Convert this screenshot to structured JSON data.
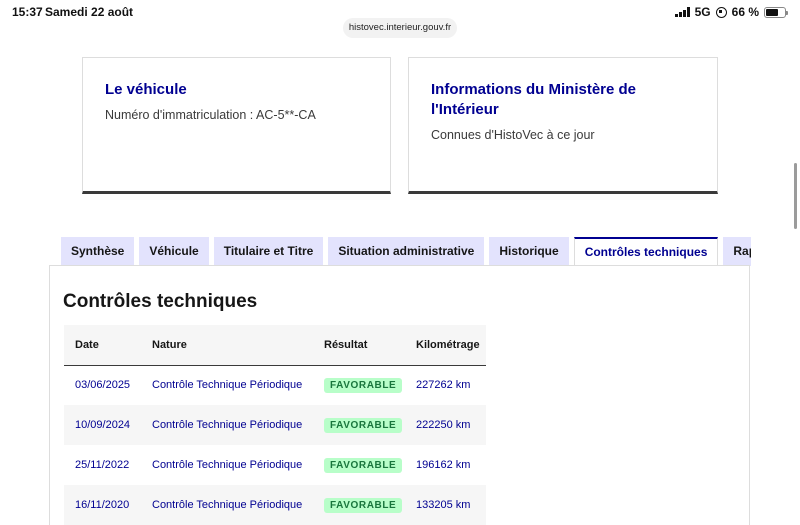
{
  "status_bar": {
    "time": "15:37",
    "date": "Samedi 22 août",
    "network": "5G",
    "battery": "66 %",
    "battery_level": 0.66
  },
  "browser": {
    "url": "histovec.interieur.gouv.fr"
  },
  "cards": [
    {
      "title": "Le véhicule",
      "text": "Numéro d'immatriculation : AC-5**-CA"
    },
    {
      "title_line1": "Informations du Ministère de",
      "title_line2": "l'Intérieur",
      "text": "Connues d'HistoVec à ce jour"
    }
  ],
  "tabs": [
    {
      "label": "Synthèse"
    },
    {
      "label": "Véhicule"
    },
    {
      "label": "Titulaire et Titre"
    },
    {
      "label": "Situation administrative"
    },
    {
      "label": "Historique"
    },
    {
      "label": "Contrôles techniques"
    },
    {
      "label": "Rap"
    }
  ],
  "active_tab": "Contrôles techniques",
  "section": {
    "title": "Contrôles techniques",
    "columns": [
      "Date",
      "Nature",
      "Résultat",
      "Kilométrage"
    ],
    "rows": [
      {
        "date": "03/06/2025",
        "nature": "Contrôle Technique Périodique",
        "result": "FAVORABLE",
        "km": "227262 km"
      },
      {
        "date": "10/09/2024",
        "nature": "Contrôle Technique Périodique",
        "result": "FAVORABLE",
        "km": "222250 km"
      },
      {
        "date": "25/11/2022",
        "nature": "Contrôle Technique Périodique",
        "result": "FAVORABLE",
        "km": "196162 km"
      },
      {
        "date": "16/11/2020",
        "nature": "Contrôle Technique Périodique",
        "result": "FAVORABLE",
        "km": "133205 km"
      }
    ]
  },
  "colors": {
    "accent": "#000091",
    "tab_bg": "#e3e3fd",
    "badge_bg": "#b8fec9",
    "badge_text": "#18753c"
  }
}
